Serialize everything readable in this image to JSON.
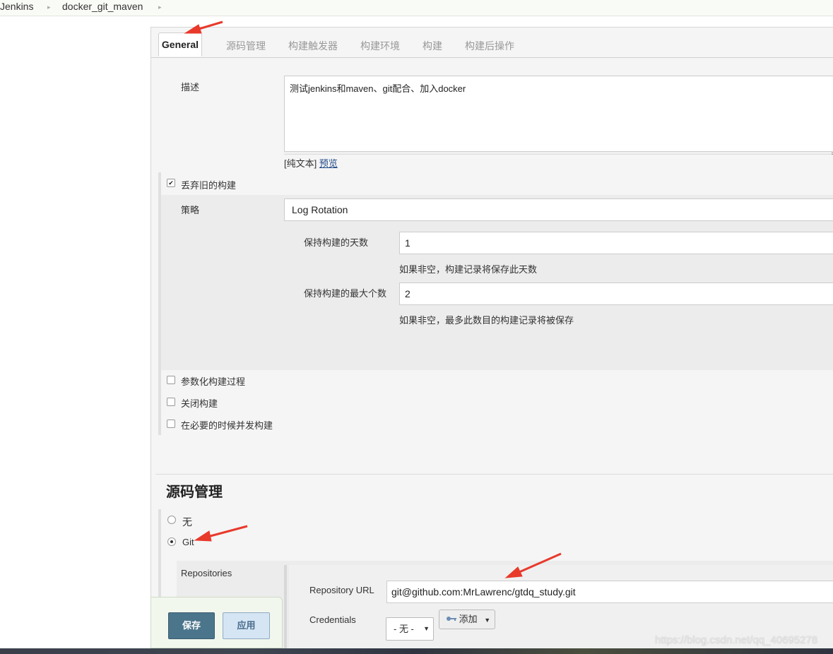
{
  "breadcrumb": {
    "items": [
      "Jenkins",
      "docker_git_maven"
    ]
  },
  "tabs": [
    {
      "label": "General",
      "active": true
    },
    {
      "label": "源码管理"
    },
    {
      "label": "构建触发器"
    },
    {
      "label": "构建环境"
    },
    {
      "label": "构建"
    },
    {
      "label": "构建后操作"
    }
  ],
  "description": {
    "label": "描述",
    "value": "测试jenkins和maven、git配合、加入docker",
    "plain_text_label": "[纯文本]",
    "preview_link": "预览"
  },
  "discard_old_builds": {
    "checked": true,
    "label": "丢弃旧的构建",
    "strategy_label": "策略",
    "strategy_value": "Log Rotation",
    "days_label": "保持构建的天数",
    "days_value": "1",
    "days_hint": "如果非空，构建记录将保存此天数",
    "max_label": "保持构建的最大个数",
    "max_value": "2",
    "max_hint": "如果非空，最多此数目的构建记录将被保存"
  },
  "options": [
    {
      "label": "参数化构建过程",
      "checked": false
    },
    {
      "label": "关闭构建",
      "checked": false
    },
    {
      "label": "在必要的时候并发构建",
      "checked": false
    }
  ],
  "scm": {
    "title": "源码管理",
    "none_label": "无",
    "git_label": "Git",
    "selected": "Git",
    "repositories_label": "Repositories",
    "repo_url_label": "Repository URL",
    "repo_url_value": "git@github.com:MrLawrenc/gtdq_study.git",
    "credentials_label": "Credentials",
    "credentials_value": "- 无 -",
    "add_button": "添加"
  },
  "buttons": {
    "save": "保存",
    "apply": "应用"
  },
  "watermark": "https://blog.csdn.net/qq_40695278",
  "colors": {
    "annotation_arrow": "#e8392b",
    "save_button": "#4b758b",
    "apply_button": "#d5e5f3"
  }
}
